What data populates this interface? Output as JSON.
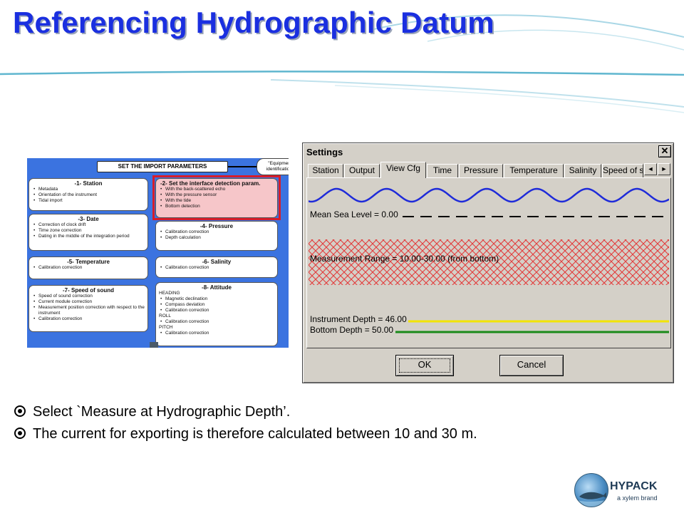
{
  "slide": {
    "title": "Referencing Hydrographic Datum",
    "bullets": [
      "Select `Measure at Hydrographic Depth’.",
      "The current for exporting is therefore calculated between 10 and 30 m."
    ],
    "logo": {
      "name": "HYPACK",
      "tagline": "a xylem brand"
    }
  },
  "diagram": {
    "header": "SET THE IMPORT PARAMETERS",
    "equipment_note": "\"Equipment identification\"",
    "boxes": [
      {
        "title": "-1- Station",
        "items": [
          "Metadata",
          "Orientation of the instrument",
          "Tidal import"
        ]
      },
      {
        "title": "-2- Set the interface detection param.",
        "items": [
          "With the back-scattered echo",
          "With the pressure sensor",
          "With the tide",
          "Bottom detection"
        ]
      },
      {
        "title": "-3- Date",
        "items": [
          "Correction of clock drift",
          "Time zone correction",
          "Dating in the middle of the integration period"
        ]
      },
      {
        "title": "-4- Pressure",
        "items": [
          "Calibration correction",
          "Depth calculation"
        ]
      },
      {
        "title": "-5- Temperature",
        "items": [
          "Calibration correction"
        ]
      },
      {
        "title": "-6- Salinity",
        "items": [
          "Calibration correction"
        ]
      },
      {
        "title": "-7- Speed of sound",
        "items": [
          "Speed of sound correction",
          "Current module correction",
          "Measurement position correction with respect to the instrument",
          "Calibration correction"
        ]
      },
      {
        "title": "-8- Attitude",
        "groups": [
          {
            "label": "HEADING",
            "items": [
              "Magnetic declination",
              "Compass deviation",
              "Calibration correction"
            ]
          },
          {
            "label": "ROLL",
            "items": [
              "Calibration correction"
            ]
          },
          {
            "label": "PITCH",
            "items": [
              "Calibration correction"
            ]
          }
        ]
      }
    ]
  },
  "dialog": {
    "title": "Settings",
    "close_glyph": "✕",
    "tabs": [
      "Station",
      "Output",
      "View Cfg",
      "Time",
      "Pressure",
      "Temperature",
      "Salinity",
      "Speed of s"
    ],
    "active_tab": "View Cfg",
    "scroll_left_glyph": "◄",
    "scroll_right_glyph": "►",
    "view": {
      "mean_sea_level_label": "Mean Sea Level = 0.00",
      "measurement_range_label": "Measurement Range = 10.00-30.00 (from bottom)",
      "instrument_depth_label": "Instrument Depth = 46.00",
      "bottom_depth_label": "Bottom Depth = 50.00",
      "colors": {
        "wave": "#1f2bd9",
        "range_hatch": "#e33b3b",
        "instrument_line": "#f2e400",
        "bottom_line": "#1a8a1a"
      }
    },
    "ok_label": "OK",
    "cancel_label": "Cancel"
  },
  "colors": {
    "title": "#1a2fe0",
    "diagram_bg": "#3b73e0",
    "highlight_frame": "#d71d2a",
    "highlight_fill": "#f6c6c9"
  }
}
